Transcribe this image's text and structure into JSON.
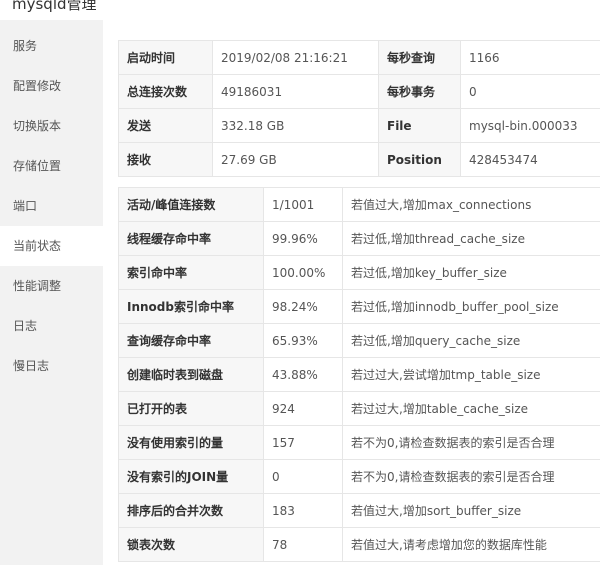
{
  "window": {
    "title": "mysqld管理"
  },
  "sidebar": {
    "items": [
      {
        "label": "服务"
      },
      {
        "label": "配置修改"
      },
      {
        "label": "切换版本"
      },
      {
        "label": "存储位置"
      },
      {
        "label": "端口"
      },
      {
        "label": "当前状态"
      },
      {
        "label": "性能调整"
      },
      {
        "label": "日志"
      },
      {
        "label": "慢日志"
      }
    ],
    "active": "当前状态"
  },
  "status": {
    "rows": [
      [
        "启动时间",
        "2019/02/08 21:16:21",
        "每秒查询",
        "1166"
      ],
      [
        "总连接次数",
        "49186031",
        "每秒事务",
        "0"
      ],
      [
        "发送",
        "332.18 GB",
        "File",
        "mysql-bin.000033"
      ],
      [
        "接收",
        "27.69 GB",
        "Position",
        "428453474"
      ]
    ]
  },
  "performance": {
    "rows": [
      [
        "活动/峰值连接数",
        "1/1001",
        "若值过大,增加max_connections"
      ],
      [
        "线程缓存命中率",
        "99.96%",
        "若过低,增加thread_cache_size"
      ],
      [
        "索引命中率",
        "100.00%",
        "若过低,增加key_buffer_size"
      ],
      [
        "Innodb索引命中率",
        "98.24%",
        "若过低,增加innodb_buffer_pool_size"
      ],
      [
        "查询缓存命中率",
        "65.93%",
        "若过低,增加query_cache_size"
      ],
      [
        "创建临时表到磁盘",
        "43.88%",
        "若过过大,尝试增加tmp_table_size"
      ],
      [
        "已打开的表",
        "924",
        "若过过大,增加table_cache_size"
      ],
      [
        "没有使用索引的量",
        "157",
        "若不为0,请检查数据表的索引是否合理"
      ],
      [
        "没有索引的JOIN量",
        "0",
        "若不为0,请检查数据表的索引是否合理"
      ],
      [
        "排序后的合并次数",
        "183",
        "若值过大,增加sort_buffer_size"
      ],
      [
        "锁表次数",
        "78",
        "若值过大,请考虑增加您的数据库性能"
      ]
    ]
  }
}
